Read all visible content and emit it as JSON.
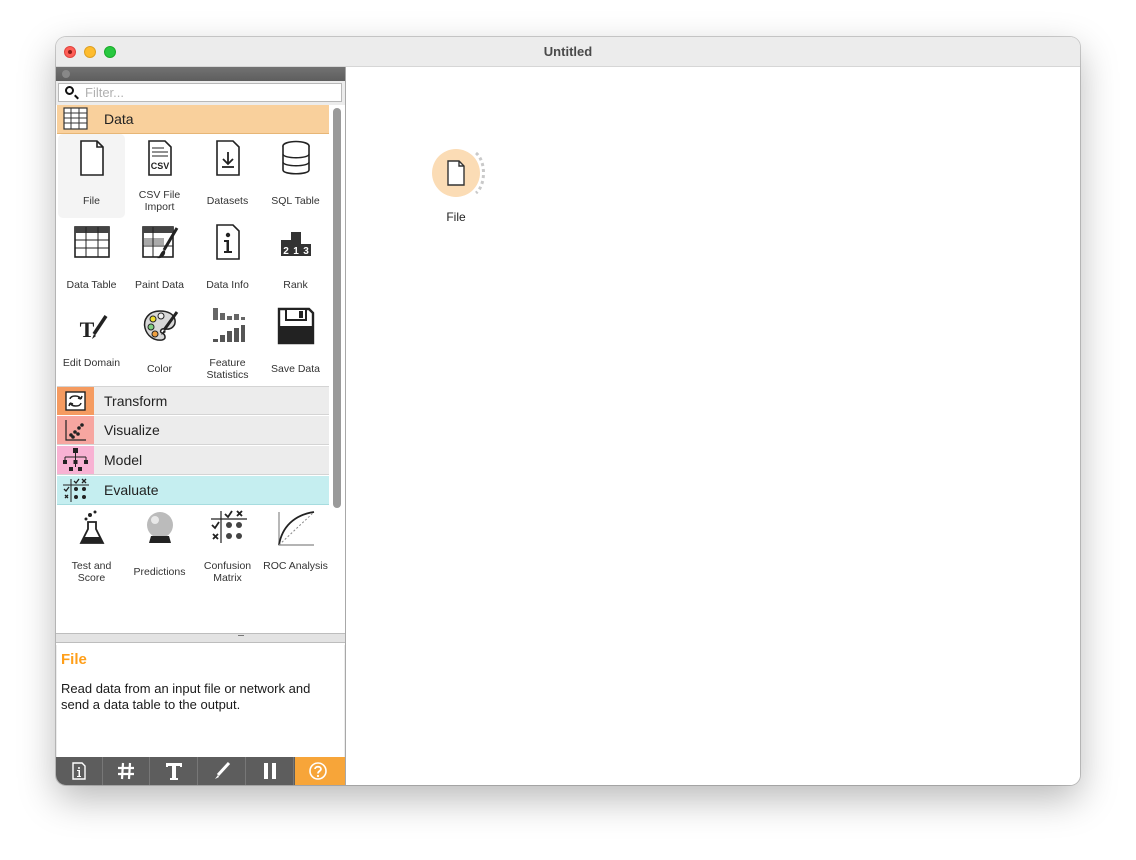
{
  "window": {
    "title": "Untitled"
  },
  "filter": {
    "placeholder": "Filter..."
  },
  "categories": {
    "data": "Data",
    "transform": "Transform",
    "visualize": "Visualize",
    "model": "Model",
    "evaluate": "Evaluate"
  },
  "data_widgets": [
    {
      "label": "File",
      "icon": "file-icon"
    },
    {
      "label": "CSV File Import",
      "icon": "csv-file-icon"
    },
    {
      "label": "Datasets",
      "icon": "datasets-icon"
    },
    {
      "label": "SQL Table",
      "icon": "database-icon"
    },
    {
      "label": "Data Table",
      "icon": "table-icon"
    },
    {
      "label": "Paint Data",
      "icon": "paint-brush-icon"
    },
    {
      "label": "Data Info",
      "icon": "info-document-icon"
    },
    {
      "label": "Rank",
      "icon": "rank-podium-icon"
    },
    {
      "label": "Edit Domain",
      "icon": "edit-text-icon"
    },
    {
      "label": "Color",
      "icon": "palette-icon"
    },
    {
      "label": "Feature Statistics",
      "icon": "bar-statistics-icon"
    },
    {
      "label": "Save Data",
      "icon": "floppy-disk-icon"
    }
  ],
  "evaluate_widgets": [
    {
      "label": "Test and Score",
      "icon": "flask-icon"
    },
    {
      "label": "Predictions",
      "icon": "crystal-ball-icon"
    },
    {
      "label": "Confusion Matrix",
      "icon": "confusion-matrix-icon"
    },
    {
      "label": "ROC Analysis",
      "icon": "roc-curve-icon"
    }
  ],
  "help": {
    "title": "File",
    "description": "Read data from an input file or network and send a data table to the output."
  },
  "canvas": {
    "nodes": [
      {
        "label": "File",
        "icon": "file-icon",
        "color": "#fbdcb5"
      }
    ]
  },
  "colors": {
    "data": "#f9d09c",
    "transform": "#f59b60",
    "visualize": "#f7a6a0",
    "model": "#f8b2d3",
    "evaluate": "#c5eef0",
    "help_accent": "#f7a539",
    "help_title": "#ff9f1a"
  }
}
